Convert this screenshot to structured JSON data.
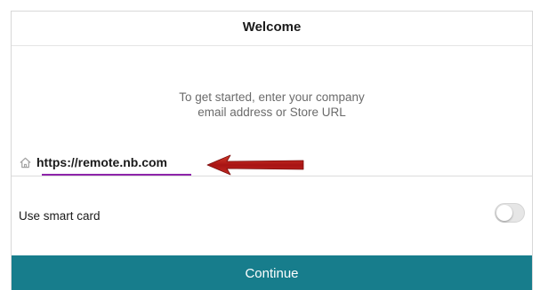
{
  "header": {
    "title": "Welcome"
  },
  "intro": {
    "line1": "To get started, enter your company",
    "line2": "email address or Store URL"
  },
  "url_field": {
    "icon": "home-icon",
    "value": "https://remote.nb.com"
  },
  "smart_card": {
    "label": "Use smart card",
    "enabled": false
  },
  "actions": {
    "continue_label": "Continue"
  },
  "annotation": {
    "icon": "red-arrow-icon",
    "color": "#b01818"
  },
  "colors": {
    "accent": "#177d8c",
    "input_underline": "#8e24aa",
    "subtitle_text": "#6b6b6b"
  }
}
